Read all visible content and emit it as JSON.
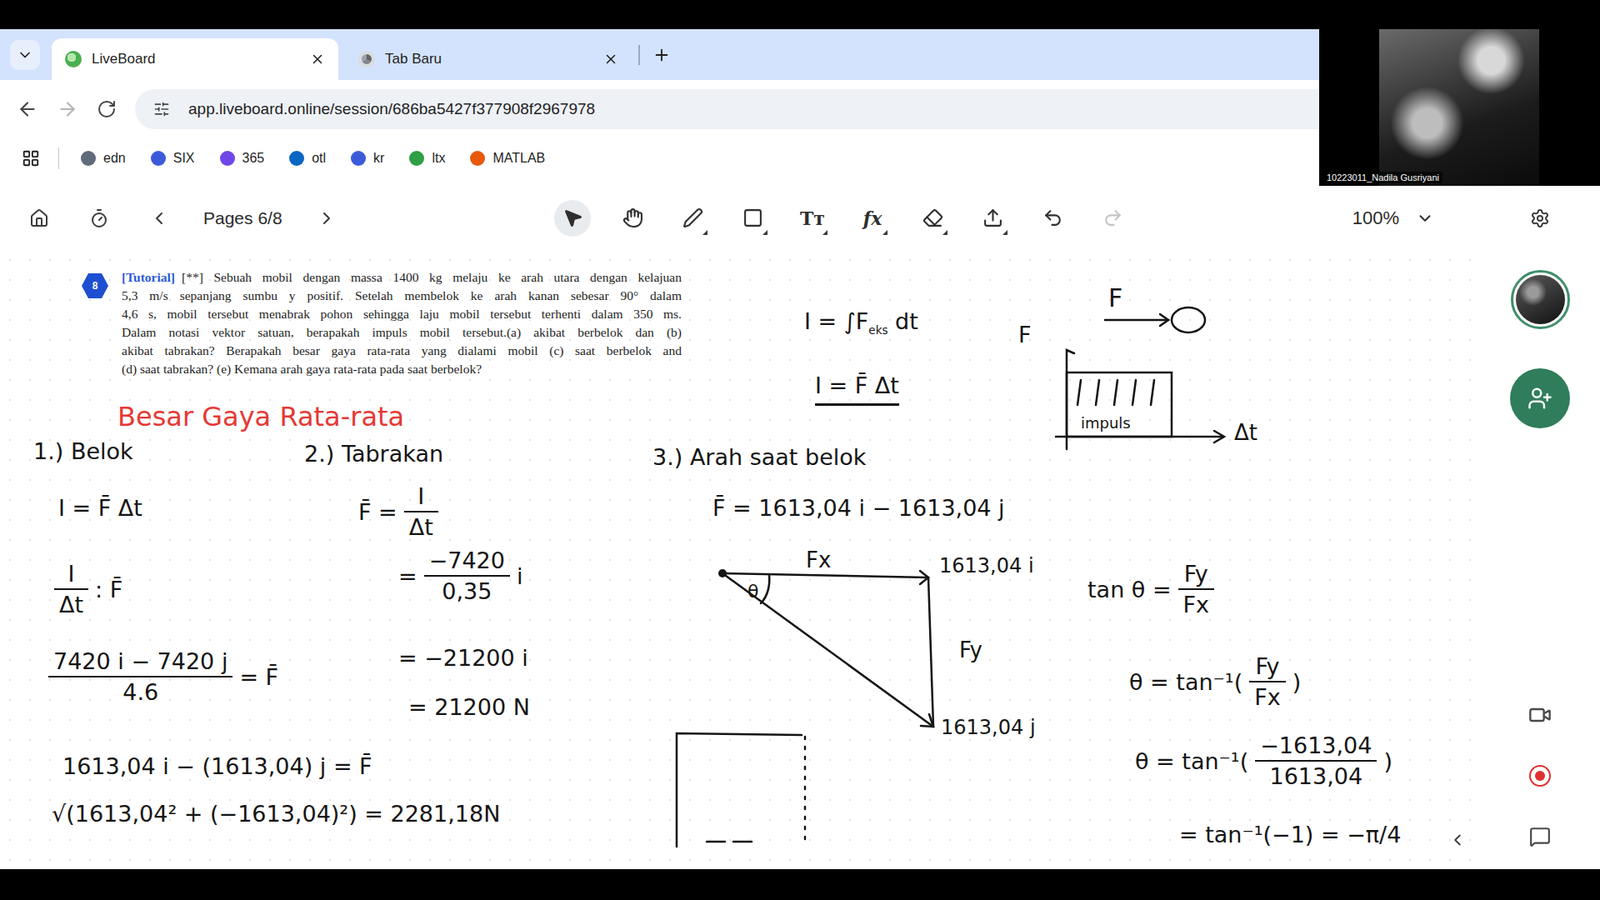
{
  "browser": {
    "tabs": [
      {
        "label": "LiveBoard",
        "selected": true
      },
      {
        "label": "Tab Baru",
        "selected": false
      }
    ],
    "navigation": {
      "back_disabled": false,
      "forward_disabled": true
    },
    "url": "app.liveboard.online/session/686ba5427f377908f2967978",
    "bookmarks": [
      {
        "label": "edn",
        "color": "#5f6b7a"
      },
      {
        "label": "SIX",
        "color": "#3b5bdb"
      },
      {
        "label": "365",
        "color": "#7048e8"
      },
      {
        "label": "otl",
        "color": "#0a66c2"
      },
      {
        "label": "kr",
        "color": "#3b5bdb"
      },
      {
        "label": "ltx",
        "color": "#2f9e44"
      },
      {
        "label": "MATLAB",
        "color": "#e8590c"
      }
    ]
  },
  "video": {
    "participant": "10223011_Nadila Gusriyani"
  },
  "toolbar": {
    "pages": "Pages 6/8",
    "zoom": "100%",
    "tools": [
      {
        "kind": "select",
        "selected": true,
        "has_menu": false,
        "disabled": false
      },
      {
        "kind": "hand",
        "selected": false,
        "has_menu": false,
        "disabled": false
      },
      {
        "kind": "pen",
        "selected": false,
        "has_menu": true,
        "disabled": false
      },
      {
        "kind": "shape",
        "selected": false,
        "has_menu": true,
        "disabled": false
      },
      {
        "kind": "text",
        "label": "Tт",
        "selected": false,
        "has_menu": true,
        "disabled": false
      },
      {
        "kind": "formula",
        "label": "fx",
        "selected": false,
        "has_menu": true,
        "disabled": false
      },
      {
        "kind": "eraser",
        "selected": false,
        "has_menu": true,
        "disabled": false
      },
      {
        "kind": "export",
        "selected": false,
        "has_menu": true,
        "disabled": false
      },
      {
        "kind": "undo",
        "selected": false,
        "has_menu": false,
        "disabled": false
      },
      {
        "kind": "redo",
        "selected": false,
        "has_menu": false,
        "disabled": true
      }
    ]
  },
  "problem": {
    "badge": "8",
    "tag": "[Tutorial]",
    "lines": [
      "[**] Sebuah mobil dengan massa 1400 kg melaju ke arah utara dengan kelajuan",
      "5,3 m/s sepanjang sumbu y positif.  Setelah membelok ke arah kanan sebesar 90° dalam",
      "4,6 s, mobil tersebut menabrak pohon sehingga laju mobil tersebut terhenti dalam 350 ms.",
      "Dalam notasi vektor satuan, berapakah impuls mobil tersebut.(a) akibat berbelok dan (b)",
      "akibat tabrakan? Berapakah besar gaya rata-rata yang dialami mobil (c) saat berbelok and",
      "(d) saat tabrakan? (e) Kemana arah gaya rata-rata pada saat berbelok?"
    ]
  },
  "notes": [
    {
      "kind": "text",
      "text": "Besar Gaya Rata-rata",
      "color": "#e53935",
      "underline": false
    },
    {
      "kind": "text",
      "text": "1.) Belok",
      "color": "#151515",
      "underline": false
    },
    {
      "kind": "text",
      "text": "I = F̄ Δt",
      "color": "#151515",
      "underline": false
    },
    {
      "kind": "fraction",
      "head": "",
      "num": "I",
      "den": "Δt",
      "tail": ": F̄",
      "color": "#151515",
      "underline": false
    },
    {
      "kind": "fraction",
      "head": "",
      "num": "7420 i − 7420 j",
      "den": "4.6",
      "tail": "= F̄",
      "color": "#151515",
      "underline": false
    },
    {
      "kind": "text",
      "text": "1613,04 i − (1613,04) j = F̄",
      "color": "#151515",
      "underline": false
    },
    {
      "kind": "text",
      "text": "√(1613,04² + (−1613,04)²) = 2281,18N",
      "color": "#151515",
      "underline": false
    },
    {
      "kind": "text",
      "text": "2.) Tabrakan",
      "color": "#151515",
      "underline": false
    },
    {
      "kind": "fraction",
      "head": "F̄ =",
      "num": "I",
      "den": "Δt",
      "tail": "",
      "color": "#151515",
      "underline": false
    },
    {
      "kind": "fraction",
      "head": "=",
      "num": "−7420",
      "den": "0,35",
      "tail": "i",
      "color": "#151515",
      "underline": false
    },
    {
      "kind": "text",
      "text": "= −21200 i",
      "color": "#151515",
      "underline": false
    },
    {
      "kind": "text",
      "text": "= 21200 N",
      "color": "#151515",
      "underline": false
    },
    {
      "kind": "text",
      "text": "3.) Arah saat belok",
      "color": "#151515",
      "underline": false
    },
    {
      "kind": "text",
      "text": "F̄ = 1613,04 i − 1613,04 j",
      "color": "#151515",
      "underline": false
    },
    {
      "kind": "fraction",
      "head": "tan θ =",
      "num": "Fy",
      "den": "Fx",
      "tail": "",
      "color": "#151515",
      "underline": false
    },
    {
      "kind": "fraction",
      "head": "θ = tan⁻¹(",
      "num": "Fy",
      "den": "Fx",
      "tail": ")",
      "color": "#151515",
      "underline": false
    },
    {
      "kind": "fraction",
      "head": "θ = tan⁻¹(",
      "num": "−1613,04",
      "den": "1613,04",
      "tail": ")",
      "color": "#151515",
      "underline": false
    },
    {
      "kind": "text",
      "text": "= tan⁻¹(−1) = −π/4",
      "color": "#151515",
      "underline": false
    },
    {
      "kind": "text",
      "text": "I = ∫F",
      "sub": "eks",
      "after": " dt",
      "color": "#151515",
      "underline": false
    },
    {
      "kind": "text",
      "text": "F",
      "color": "#151515",
      "underline": false
    },
    {
      "kind": "text",
      "text": "I = F̄ Δt",
      "color": "#151515",
      "underline": true
    }
  ],
  "diagram": {
    "angle": "θ",
    "fx": "Fx",
    "fy": "Fy",
    "x_value": "1613,04 i",
    "y_value": "1613,04 j"
  },
  "impulse_graph": {
    "box_label": "impuls",
    "x_label": "Δt"
  },
  "force_sketch": {
    "label": "F"
  }
}
